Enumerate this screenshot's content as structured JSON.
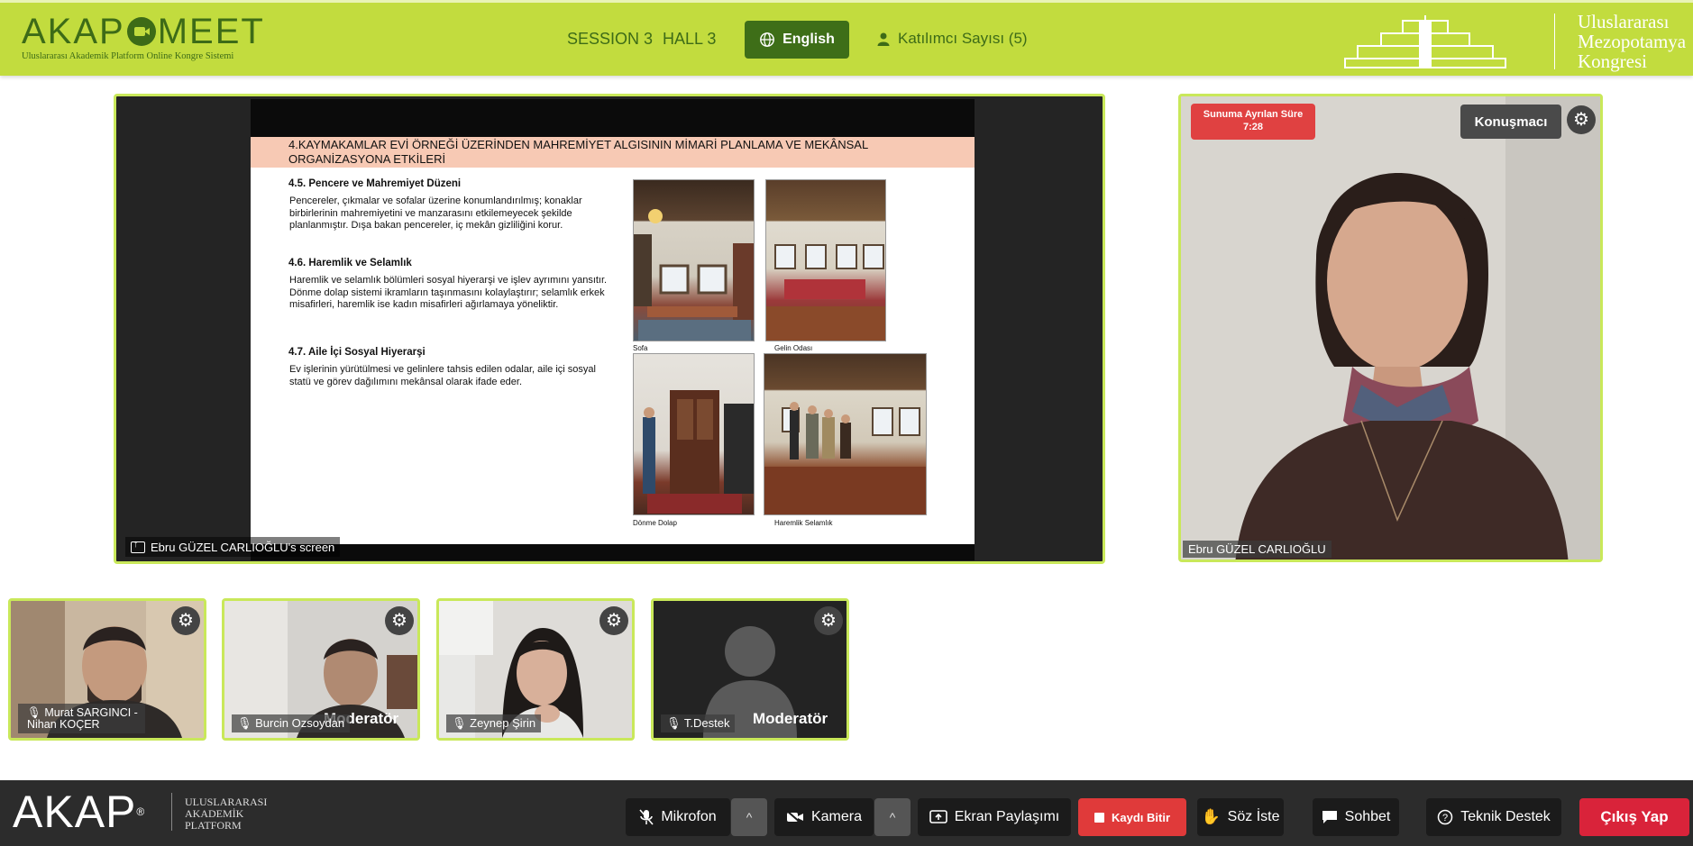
{
  "header": {
    "logo_left": "AKAP",
    "logo_right": "MEET",
    "logo_subtitle": "Uluslararası Akademik Platform Online Kongre Sistemi",
    "session": "SESSION 3",
    "hall": "HALL 3",
    "language_button": "English",
    "participants": "Katılımcı Sayısı (5)",
    "congress_line1": "Uluslararası",
    "congress_line2": "Mezopotamya",
    "congress_line3": "Kongresi"
  },
  "slide": {
    "title": "4.KAYMAKAMLAR EVİ ÖRNEĞİ ÜZERİNDEN MAHREMİYET ALGISININ MİMARİ PLANLAMA VE MEKÂNSAL ORGANİZASYONA ETKİLERİ",
    "sections": [
      {
        "heading": "4.5. Pencere ve Mahremiyet Düzeni",
        "text": "Pencereler, çıkmalar ve sofalar üzerine konumlandırılmış; konaklar birbirlerinin mahremiyetini ve manzarasını etkilemeyecek şekilde planlanmıştır. Dışa bakan pencereler, iç mekân gizliliğini korur."
      },
      {
        "heading": "4.6. Haremlik ve Selamlık",
        "text": "Haremlik ve selamlık bölümleri sosyal hiyerarşi ve işlev ayrımını yansıtır. Dönme dolap sistemi ikramların taşınmasını kolaylaştırır; selamlık erkek misafirleri, haremlik ise kadın misafirleri ağırlamaya yöneliktir."
      },
      {
        "heading": "4.7. Aile İçi Sosyal Hiyerarşi",
        "text": "Ev işlerinin yürütülmesi ve gelinlere tahsis edilen odalar, aile içi sosyal statü ve görev dağılımını mekânsal olarak ifade eder."
      }
    ],
    "captions": [
      "Sofa",
      "Gelin Odası",
      "Dönme Dolap",
      "Haremlik Selamlık"
    ],
    "screen_label": "Ebru GÜZEL CARLIOĞLU's screen"
  },
  "speaker": {
    "timer_label": "Sunuma Ayrılan Süre",
    "timer_value": "7:28",
    "role_badge": "Konuşmacı",
    "name": "Ebru GÜZEL CARLIOĞLU"
  },
  "tiles": [
    {
      "name_line1": "Murat SARGINCI -",
      "name_line2": "Nihan KOÇER",
      "moderator": ""
    },
    {
      "name_line1": "Burcin Ozsoydan",
      "name_line2": "",
      "moderator": "Moderatör"
    },
    {
      "name_line1": "Zeynep Şirin",
      "name_line2": "",
      "moderator": ""
    },
    {
      "name_line1": "T.Destek",
      "name_line2": "",
      "moderator": "Moderatör"
    }
  ],
  "bottom": {
    "brand": "AKAP",
    "brand_reg": "®",
    "brand_sub1": "ULUSLARARASI",
    "brand_sub2": "AKADEMİK",
    "brand_sub3": "PLATFORM",
    "mic": "Mikrofon",
    "camera": "Kamera",
    "screen_share": "Ekran Paylaşımı",
    "record": "Kaydı Bitir",
    "raise_hand": "Söz İste",
    "chat": "Sohbet",
    "support": "Teknik Destek",
    "exit": "Çıkış Yap"
  },
  "colors": {
    "header_bg": "#c2dc3e",
    "header_text": "#3d6b17",
    "accent_border": "#c9e85a",
    "record_red": "#e03a3a",
    "exit_red": "#d9233a"
  }
}
